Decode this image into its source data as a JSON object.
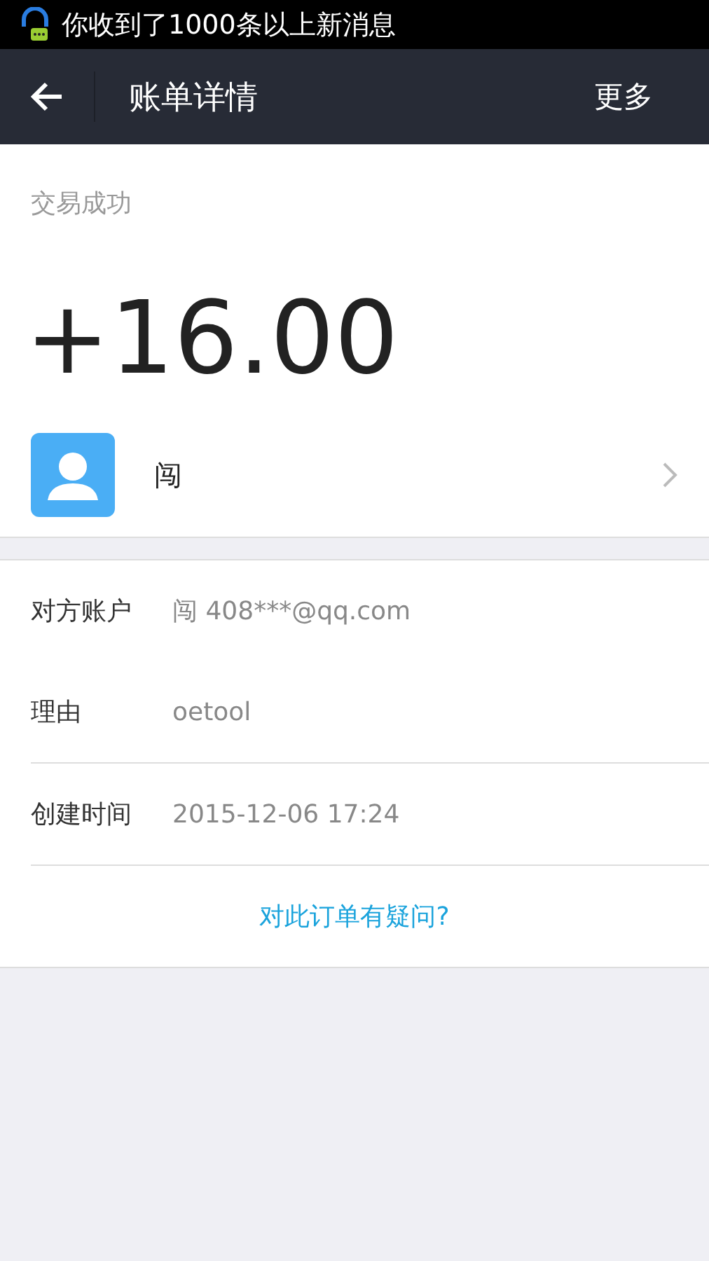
{
  "status_bar": {
    "notification": "你收到了1000条以上新消息"
  },
  "header": {
    "title": "账单详情",
    "more": "更多"
  },
  "transaction": {
    "status": "交易成功",
    "amount": "+16.00",
    "counterparty": "闯"
  },
  "details": [
    {
      "label": "对方账户",
      "value": "闯 408***@qq.com"
    },
    {
      "label": "理由",
      "value": "oetool"
    },
    {
      "label": "创建时间",
      "value": "2015-12-06 17:24"
    }
  ],
  "question_link": "对此订单有疑问?"
}
